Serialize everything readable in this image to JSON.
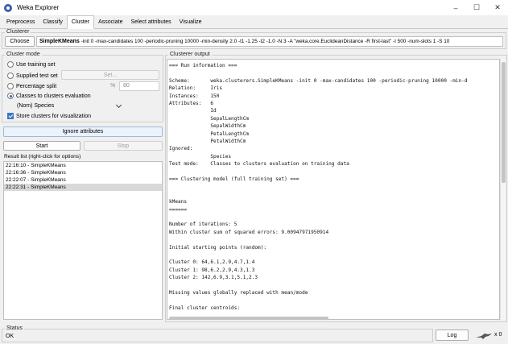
{
  "window": {
    "title": "Weka Explorer",
    "controls": [
      "–",
      "☐",
      "✕"
    ]
  },
  "tabs": [
    {
      "label": "Preprocess",
      "active": false
    },
    {
      "label": "Classify",
      "active": false
    },
    {
      "label": "Cluster",
      "active": true
    },
    {
      "label": "Associate",
      "active": false
    },
    {
      "label": "Select attributes",
      "active": false
    },
    {
      "label": "Visualize",
      "active": false
    }
  ],
  "clusterer": {
    "group_title": "Clusterer",
    "choose_label": "Choose",
    "name": "SimpleKMeans",
    "options": " -init 0 -max-candidates 100 -periodic-pruning 10000 -min-density 2.0 -t1 -1.25 -t2 -1.0 -N 3 -A \"weka.core.EuclideanDistance -R first-last\" -I 500 -num-slots 1 -S 10"
  },
  "cluster_mode": {
    "group_title": "Cluster mode",
    "use_training_set": "Use training set",
    "supplied_test_set": "Supplied test set",
    "set_label": "Set...",
    "percentage_split": "Percentage split",
    "percent_sign": "%",
    "percent_value": "80",
    "classes_to_clusters": "Classes to clusters evaluation",
    "class_attribute": "(Nom) Species",
    "store_clusters": "Store clusters for visualization",
    "selected": "classes_to_clusters"
  },
  "ignore_attributes_label": "Ignore attributes",
  "start_label": "Start",
  "stop_label": "Stop",
  "result_list": {
    "title": "Result list (right-click for options)",
    "items": [
      "22:16:10 - SimpleKMeans",
      "22:16:36 - SimpleKMeans",
      "22:22:07 - SimpleKMeans",
      "22:22:31 - SimpleKMeans"
    ],
    "selected_index": 3
  },
  "output": {
    "title": "Clusterer output",
    "lines": [
      "=== Run information ===",
      "",
      "Scheme:       weka.clusterers.SimpleKMeans -init 0 -max-candidates 100 -periodic-pruning 10000 -min-d",
      "Relation:     Iris",
      "Instances:    150",
      "Attributes:   6",
      "              Id",
      "              SepalLengthCm",
      "              SepalWidthCm",
      "              PetalLengthCm",
      "              PetalWidthCm",
      "Ignored:",
      "              Species",
      "Test mode:    Classes to clusters evaluation on training data",
      "",
      "=== Clustering model (full training set) ===",
      "",
      "",
      "kMeans",
      "======",
      "",
      "Number of iterations: 5",
      "Within cluster sum of squared errors: 9.00947971950914",
      "",
      "Initial starting points (random):",
      "",
      "Cluster 0: 64,6.1,2.9,4.7,1.4",
      "Cluster 1: 98,6.2,2.9,4.3,1.3",
      "Cluster 2: 142,6.9,3.1,5.1,2.3",
      "",
      "Missing values globally replaced with mean/mode",
      "",
      "Final cluster centroids:"
    ]
  },
  "status": {
    "group_title": "Status",
    "text": "OK"
  },
  "log_label": "Log",
  "task_count": "x 0"
}
